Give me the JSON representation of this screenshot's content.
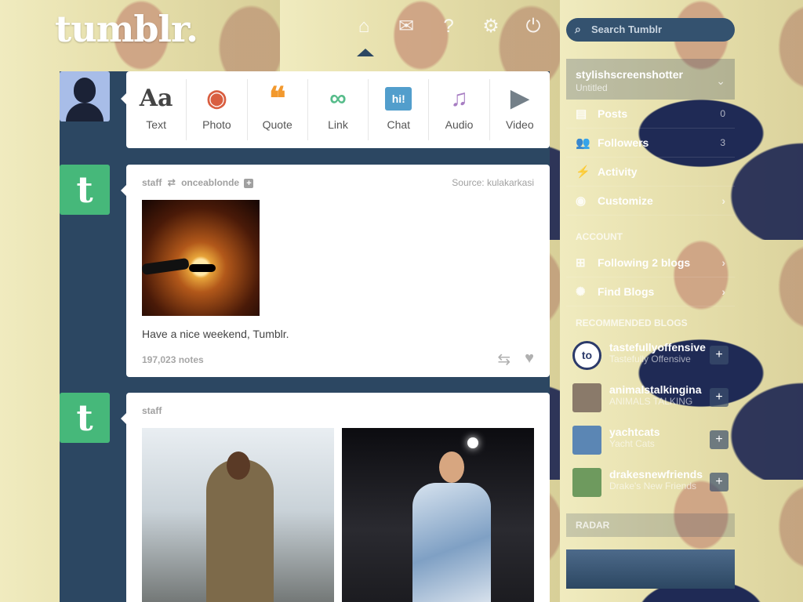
{
  "app": {
    "logo": "tumblr."
  },
  "nav": {
    "icons": [
      "home-icon",
      "mail-icon",
      "help-icon",
      "settings-icon",
      "power-icon"
    ]
  },
  "search": {
    "placeholder": "Search Tumblr"
  },
  "post_types": [
    {
      "label": "Text",
      "glyph": "Aa",
      "color": "#444444"
    },
    {
      "label": "Photo",
      "glyph": "◉",
      "color": "#d95e40"
    },
    {
      "label": "Quote",
      "glyph": "❝",
      "color": "#f2992e"
    },
    {
      "label": "Link",
      "glyph": "∞",
      "color": "#56bc8a"
    },
    {
      "label": "Chat",
      "glyph": "hi!",
      "color": "#529ecc"
    },
    {
      "label": "Audio",
      "glyph": "♫",
      "color": "#a77dc2"
    },
    {
      "label": "Video",
      "glyph": "▶",
      "color": "#748089"
    }
  ],
  "posts": [
    {
      "author": "staff",
      "reblogged_from": "onceablonde",
      "source_label": "Source:",
      "source": "kulakarkasi",
      "caption": "Have a nice weekend, Tumblr.",
      "notes": "197,023 notes"
    },
    {
      "author": "staff"
    }
  ],
  "sidebar": {
    "blog_name": "stylishscreenshotter",
    "blog_title": "Untitled",
    "rows": [
      {
        "label": "Posts",
        "count": "0"
      },
      {
        "label": "Followers",
        "count": "3"
      },
      {
        "label": "Activity",
        "count": ""
      },
      {
        "label": "Customize",
        "count": ""
      }
    ],
    "account_header": "ACCOUNT",
    "account_rows": [
      {
        "label": "Following 2 blogs"
      },
      {
        "label": "Find Blogs"
      }
    ],
    "recommended_header": "RECOMMENDED BLOGS",
    "recommended": [
      {
        "name": "tastefullyoffensive",
        "title": "Tastefully Offensive"
      },
      {
        "name": "animalstalkingina",
        "title": "ANIMALS TALKING"
      },
      {
        "name": "yachtcats",
        "title": "Yacht Cats"
      },
      {
        "name": "drakesnewfriends",
        "title": "Drake's New Friends"
      }
    ],
    "radar_header": "RADAR"
  },
  "colors": {
    "dash_blue": "#2c4762",
    "staff_green": "#46b87a"
  }
}
